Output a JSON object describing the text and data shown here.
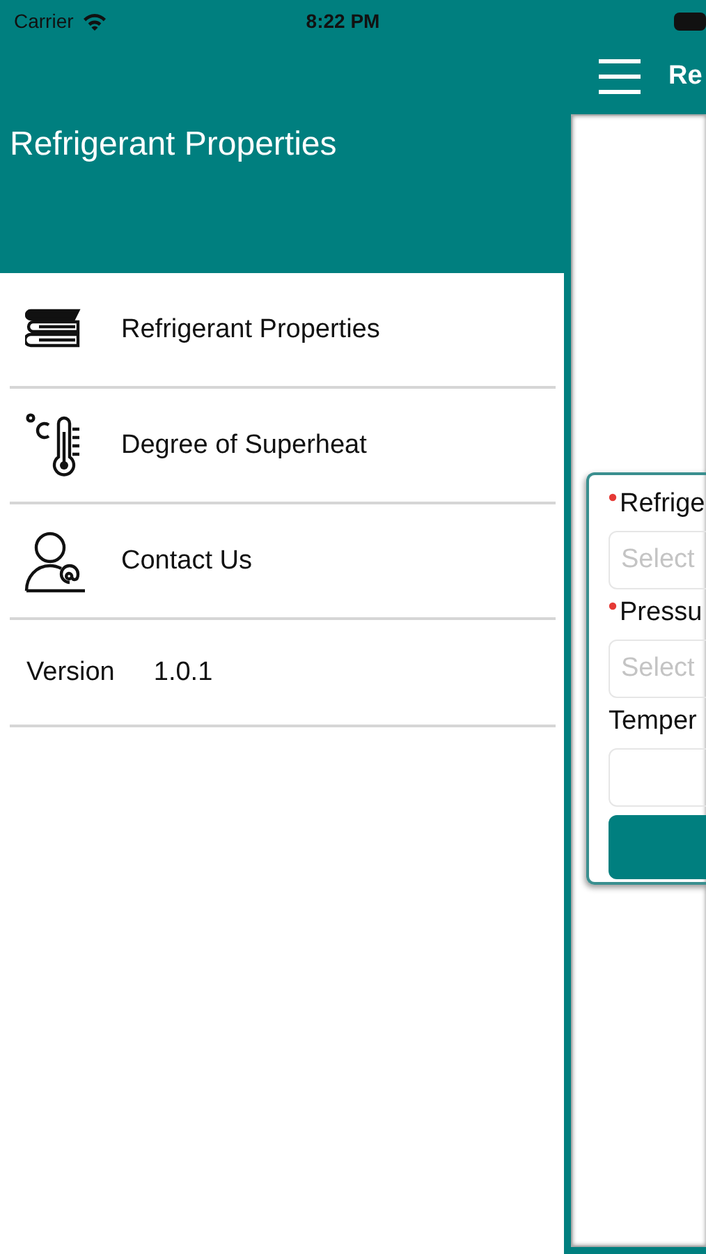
{
  "status_bar": {
    "carrier": "Carrier",
    "time": "8:22 PM"
  },
  "drawer": {
    "title": "Refrigerant Properties",
    "items": [
      {
        "kind": "books",
        "label": "Refrigerant Properties"
      },
      {
        "kind": "thermometer",
        "label": "Degree of Superheat"
      },
      {
        "kind": "contact",
        "label": "Contact Us"
      }
    ],
    "version": {
      "label": "Version",
      "value": "1.0.1"
    }
  },
  "main": {
    "title": "Re",
    "form": {
      "fields": [
        {
          "label": "Refrige",
          "required": true,
          "kind": "select",
          "placeholder": "Select"
        },
        {
          "label": "Pressu",
          "required": true,
          "kind": "select",
          "placeholder": "Select"
        },
        {
          "label": "Temper",
          "required": false,
          "kind": "input"
        }
      ]
    }
  }
}
